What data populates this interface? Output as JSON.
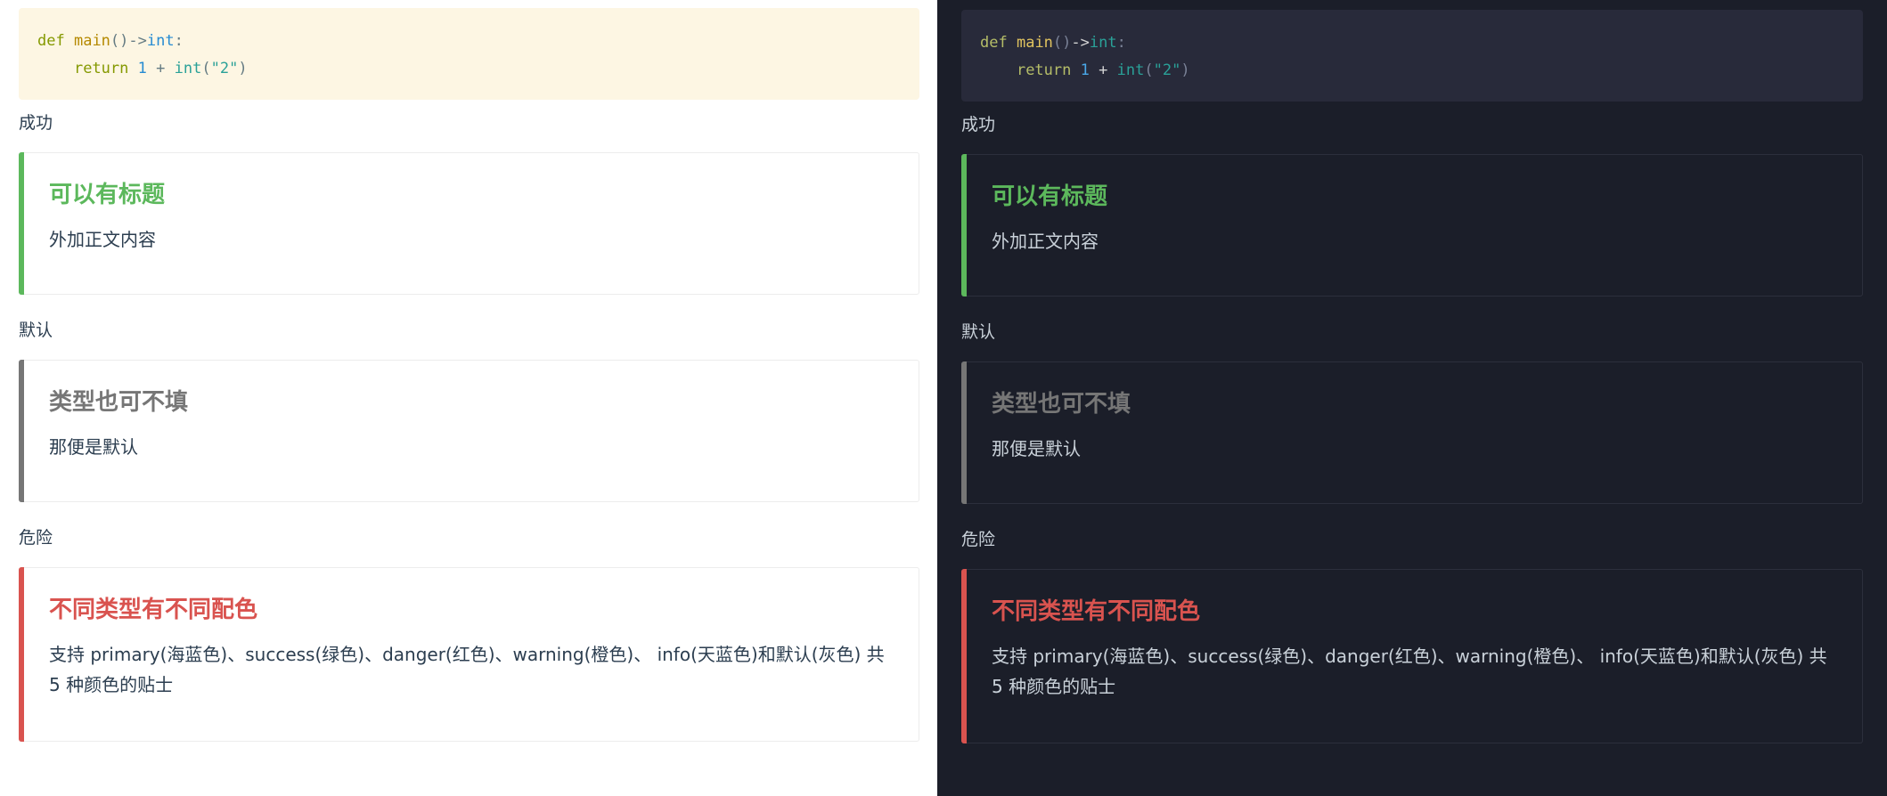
{
  "code": {
    "line1": {
      "kw": "def",
      "fn": "main",
      "punc": "()",
      "arrow": "->",
      "type": "int",
      "colon": ":"
    },
    "line2": {
      "indent": "    ",
      "kw": "return",
      "num": "1",
      "op": "+",
      "call": "int",
      "paren_open": "(",
      "str": "\"2\"",
      "paren_close": ")"
    }
  },
  "sections": {
    "success": {
      "label": "成功",
      "title": "可以有标题",
      "body": "外加正文内容"
    },
    "default": {
      "label": "默认",
      "title": "类型也可不填",
      "body": "那便是默认"
    },
    "danger": {
      "label": "危险",
      "title": "不同类型有不同配色",
      "body": "支持 primary(海蓝色)、success(绿色)、danger(红色)、warning(橙色)、 info(天蓝色)和默认(灰色) 共 5 种颜色的贴士"
    }
  },
  "colors": {
    "success": "#5cb85c",
    "default": "#767676",
    "danger": "#d9534f",
    "light_code_bg": "#fdf6e3",
    "dark_bg": "#1b1e29",
    "dark_code_bg": "#282a3a"
  },
  "themes": [
    "light",
    "dark"
  ]
}
